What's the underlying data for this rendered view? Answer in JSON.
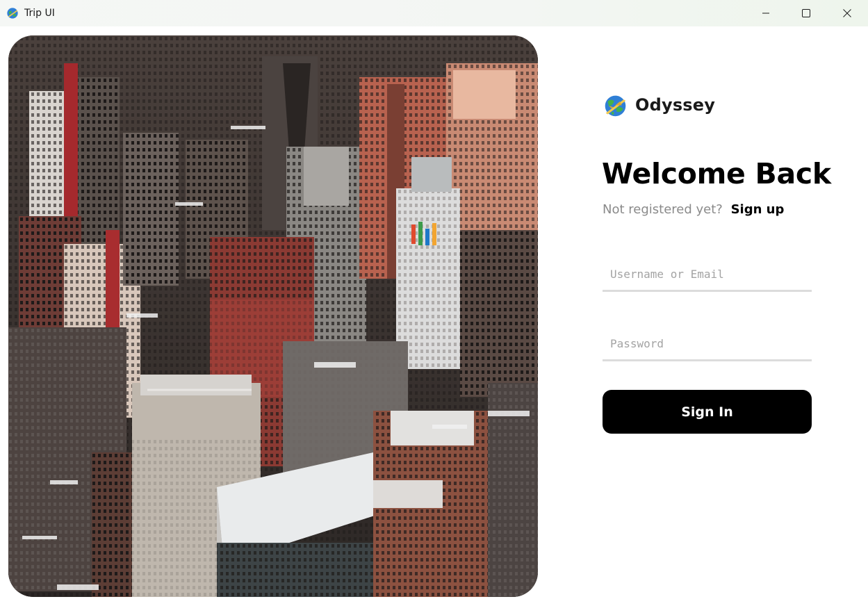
{
  "window": {
    "title": "Trip UI",
    "controls": {
      "minimize": "minimize-icon",
      "maximize": "maximize-icon",
      "close": "close-icon"
    }
  },
  "hero": {
    "image": "city-skyline-aerial-photo"
  },
  "brand": {
    "name": "Odyssey",
    "icon": "globe-airplane-icon"
  },
  "login": {
    "heading": "Welcome Back",
    "prompt": "Not registered yet?",
    "signup_label": "Sign up",
    "username": {
      "value": "",
      "placeholder": "Username or Email"
    },
    "password": {
      "value": "",
      "placeholder": "Password"
    },
    "signin_label": "Sign In"
  },
  "colors": {
    "primary_button": "#000000",
    "muted_text": "#8a8a8a",
    "field_underline": "#dcdcdc"
  }
}
